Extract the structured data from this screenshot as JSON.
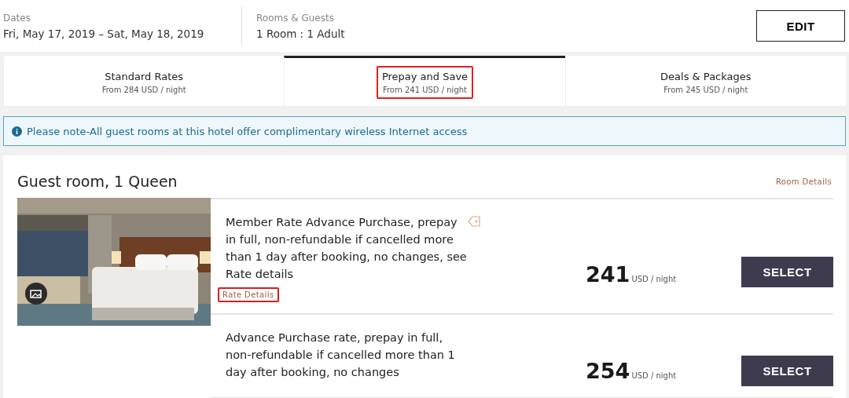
{
  "search_summary": {
    "dates_label": "Dates",
    "dates_value": "Fri, May 17, 2019 – Sat, May 18, 2019",
    "guests_label": "Rooms & Guests",
    "guests_value": "1 Room : 1 Adult",
    "edit_button": "EDIT"
  },
  "tabs": [
    {
      "title": "Standard Rates",
      "subtitle": "From 284 USD / night",
      "selected": false,
      "highlighted": false
    },
    {
      "title": "Prepay and Save",
      "subtitle": "From 241 USD / night",
      "selected": true,
      "highlighted": true
    },
    {
      "title": "Deals & Packages",
      "subtitle": "From 245 USD / night",
      "selected": false,
      "highlighted": false
    }
  ],
  "notice": "Please note-All guest rooms at this hotel offer complimentary wireless Internet access",
  "room": {
    "title": "Guest room, 1 Queen",
    "details_link": "Room Details",
    "rates": [
      {
        "description": "Member Rate Advance Purchase, prepay in full, non-refundable if cancelled more than 1 day after booking, no changes, see Rate details",
        "member_tag": true,
        "link": "Rate Details",
        "link_highlighted": true,
        "price": "241",
        "unit": "USD / night",
        "button": "SELECT"
      },
      {
        "description": "Advance Purchase rate, prepay in full, non-refundable if cancelled more than 1 day after booking, no changes",
        "member_tag": false,
        "price": "254",
        "unit": "USD / night",
        "button": "SELECT"
      }
    ]
  }
}
